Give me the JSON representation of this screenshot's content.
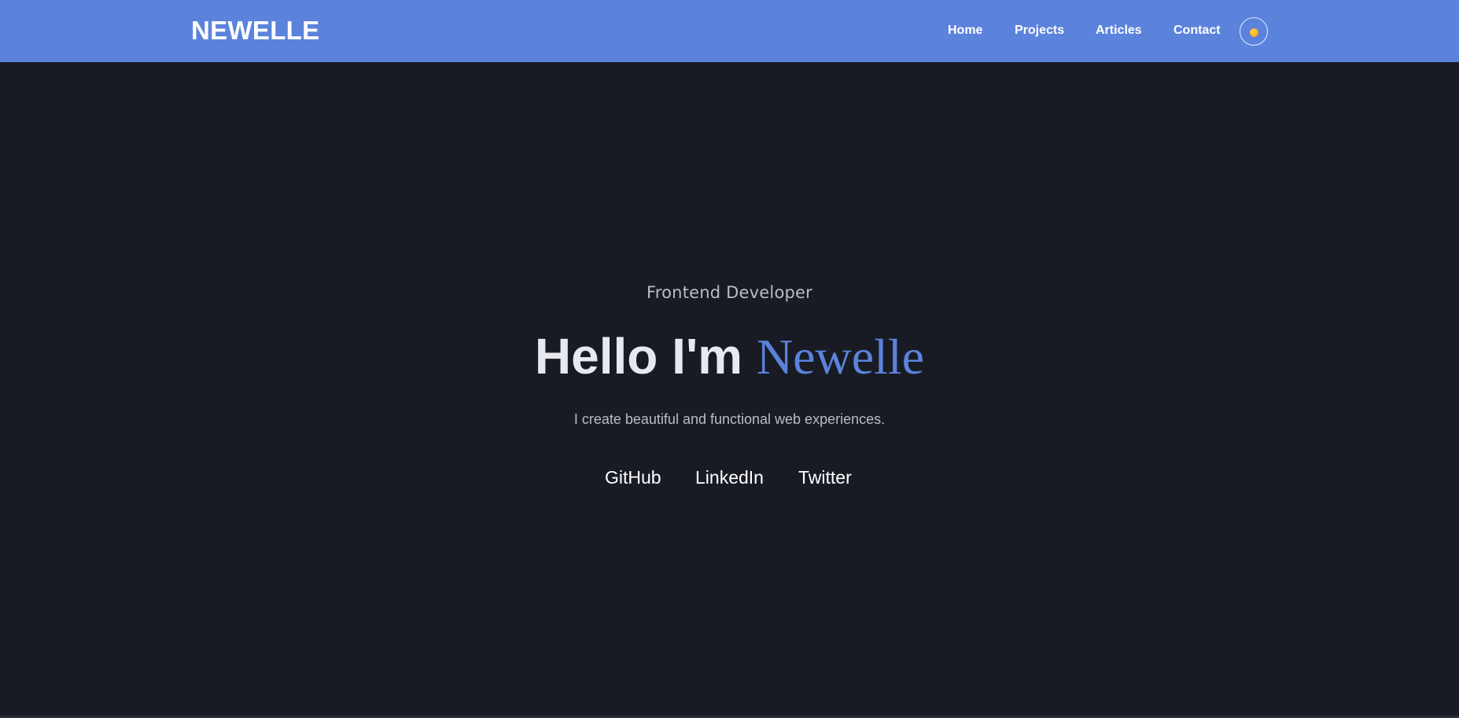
{
  "header": {
    "logo": "NEWELLE",
    "nav": [
      "Home",
      "Projects",
      "Articles",
      "Contact"
    ],
    "theme_toggle_icon": "sun-icon"
  },
  "hero": {
    "subtitle": "Frontend Developer",
    "greeting": "Hello I'm",
    "name": "Newelle",
    "tagline": "I create beautiful and functional web experiences.",
    "social": [
      "GitHub",
      "LinkedIn",
      "Twitter"
    ]
  },
  "colors": {
    "accent": "#5b83dc",
    "background": "#191b24",
    "heading": "#e8e9ee",
    "muted": "#b9bcc7"
  }
}
